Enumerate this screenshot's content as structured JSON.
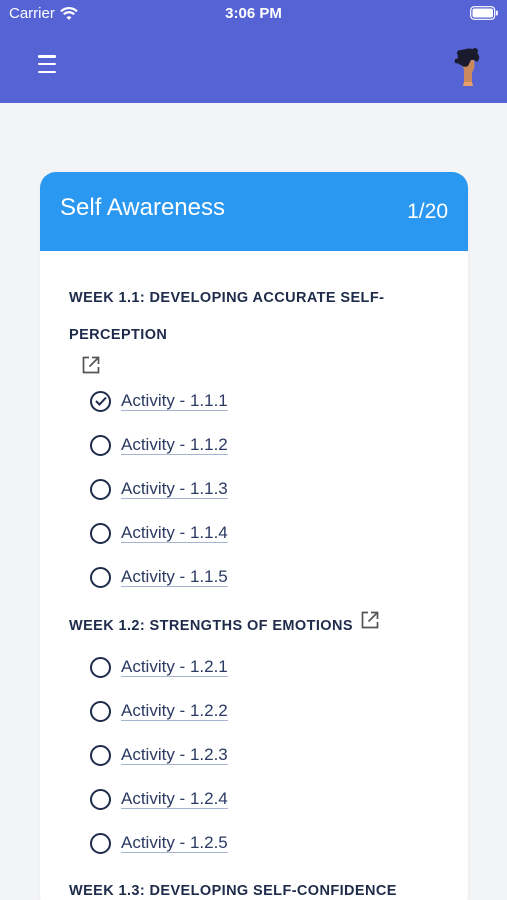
{
  "status_bar": {
    "carrier": "Carrier",
    "time": "3:06 PM"
  },
  "header": {
    "menu_icon": "hamburger-menu-icon",
    "avatar_icon": "user-avatar"
  },
  "card": {
    "title": "Self Awareness",
    "counter": "1/20",
    "header_color": "#2a97f0"
  },
  "weeks": [
    {
      "title_line1": "WEEK 1.1: DEVELOPING ACCURATE SELF-",
      "title_line2": "PERCEPTION",
      "activities": [
        {
          "label": "Activity - 1.1.1",
          "completed": true
        },
        {
          "label": "Activity - 1.1.2",
          "completed": false
        },
        {
          "label": "Activity - 1.1.3",
          "completed": false
        },
        {
          "label": "Activity - 1.1.4",
          "completed": false
        },
        {
          "label": "Activity - 1.1.5",
          "completed": false
        }
      ]
    },
    {
      "title_line1": "WEEK 1.2: STRENGTHS OF EMOTIONS",
      "activities": [
        {
          "label": "Activity - 1.2.1",
          "completed": false
        },
        {
          "label": "Activity - 1.2.2",
          "completed": false
        },
        {
          "label": "Activity - 1.2.3",
          "completed": false
        },
        {
          "label": "Activity - 1.2.4",
          "completed": false
        },
        {
          "label": "Activity - 1.2.5",
          "completed": false
        }
      ]
    },
    {
      "title_line1": "WEEK 1.3: DEVELOPING SELF-CONFIDENCE"
    }
  ],
  "colors": {
    "header_bg": "#5563d4",
    "accent": "#2a97f0",
    "text_dark": "#1e2b4a"
  }
}
